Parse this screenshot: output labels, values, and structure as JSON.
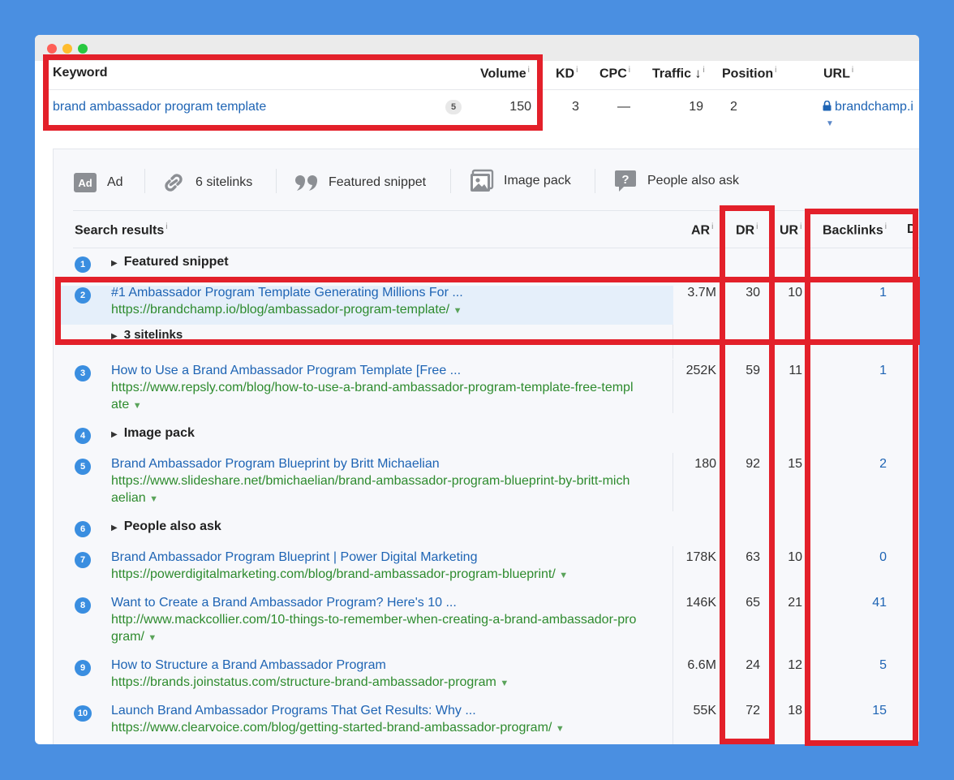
{
  "columns": {
    "keyword": "Keyword",
    "volume": "Volume",
    "kd": "KD",
    "cpc": "CPC",
    "traffic": "Traffic",
    "position": "Position",
    "url": "URL",
    "info": "i",
    "sort_arrow": "↓"
  },
  "keyword_row": {
    "keyword": "brand ambassador program template",
    "badge": "5",
    "volume": "150",
    "kd": "3",
    "cpc": "—",
    "traffic": "19",
    "position": "2",
    "url": "brandchamp.i",
    "url_caret": "▼"
  },
  "features": [
    {
      "icon": "ad-icon",
      "label": "Ad"
    },
    {
      "icon": "link-icon",
      "label": "6 sitelinks"
    },
    {
      "icon": "quote-icon",
      "label": "Featured snippet"
    },
    {
      "icon": "image-icon",
      "label": "Image pack"
    },
    {
      "icon": "question-icon",
      "label": "People also ask"
    }
  ],
  "serp_columns": {
    "search_results": "Search results",
    "ar": "AR",
    "dr": "DR",
    "ur": "UR",
    "backlinks": "Backlinks",
    "cut": "D"
  },
  "results": [
    {
      "n": "1",
      "group": "Featured snippet"
    },
    {
      "n": "2",
      "title": "#1 Ambassador Program Template Generating Millions For ...",
      "url1": "https://brandchamp.io/blog/ambassador-program-template/",
      "ar": "3.7M",
      "dr": "30",
      "ur": "10",
      "bl": "1",
      "sub": "3 sitelinks"
    },
    {
      "n": "3",
      "title": "How to Use a Brand Ambassador Program Template [Free ...",
      "url1": "https://www.repsly.com/blog/how-to-use-a-brand-ambassador-program-template-free-templ",
      "url2": "ate",
      "ar": "252K",
      "dr": "59",
      "ur": "11",
      "bl": "1"
    },
    {
      "n": "4",
      "group": "Image pack"
    },
    {
      "n": "5",
      "title": "Brand Ambassador Program Blueprint by Britt Michaelian",
      "url1": "https://www.slideshare.net/bmichaelian/brand-ambassador-program-blueprint-by-britt-mich",
      "url2": "aelian",
      "ar": "180",
      "dr": "92",
      "ur": "15",
      "bl": "2"
    },
    {
      "n": "6",
      "group": "People also ask"
    },
    {
      "n": "7",
      "title": "Brand Ambassador Program Blueprint | Power Digital Marketing",
      "url1": "https://powerdigitalmarketing.com/blog/brand-ambassador-program-blueprint/",
      "ar": "178K",
      "dr": "63",
      "ur": "10",
      "bl": "0"
    },
    {
      "n": "8",
      "title": "Want to Create a Brand Ambassador Program? Here's 10 ...",
      "url1": "http://www.mackcollier.com/10-things-to-remember-when-creating-a-brand-ambassador-pro",
      "url2": "gram/",
      "ar": "146K",
      "dr": "65",
      "ur": "21",
      "bl": "41"
    },
    {
      "n": "9",
      "title": "How to Structure a Brand Ambassador Program",
      "url1": "https://brands.joinstatus.com/structure-brand-ambassador-program",
      "ar": "6.6M",
      "dr": "24",
      "ur": "12",
      "bl": "5"
    },
    {
      "n": "10",
      "title": "Launch Brand Ambassador Programs That Get Results: Why ...",
      "url1": "https://www.clearvoice.com/blog/getting-started-brand-ambassador-program/",
      "ar": "55K",
      "dr": "72",
      "ur": "18",
      "bl": "15"
    }
  ],
  "glyphs": {
    "tri": "▶",
    "caret": "▼"
  },
  "colors": {
    "highlight": "#e3202a",
    "link": "#1e64b4",
    "url": "#2e8b2e",
    "badge": "#3a8ee0",
    "background": "#4a8fe1"
  }
}
